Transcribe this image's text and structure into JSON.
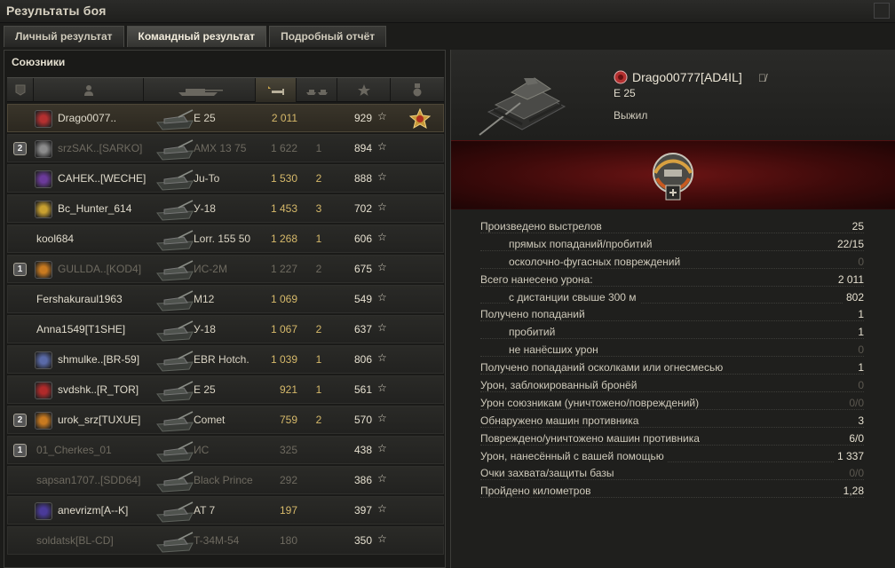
{
  "window": {
    "title": "Результаты боя"
  },
  "tabs": [
    {
      "label": "Личный результат",
      "active": false
    },
    {
      "label": "Командный результат",
      "active": true
    },
    {
      "label": "Подробный отчёт",
      "active": false
    }
  ],
  "team": {
    "label": "Союзники",
    "columns": [
      "platoon-icon",
      "player-icon",
      "tank-icon",
      "damage-icon",
      "frags-icon",
      "xp-star-icon",
      "medal-icon"
    ],
    "rows": [
      {
        "platoon": "",
        "name": "Drago0077..",
        "tank": "E 25",
        "damage": "2 011",
        "frags": "",
        "xp": "929",
        "alive": true,
        "self": true,
        "emblem": "#b43030",
        "medal": true
      },
      {
        "platoon": "2",
        "name": "srzSAK..[SARKO]",
        "tank": "AMX 13 75",
        "damage": "1 622",
        "frags": "1",
        "xp": "894",
        "alive": false,
        "emblem": "#8c8c8c"
      },
      {
        "platoon": "",
        "name": "CAHEK..[WECHE]",
        "tank": "Ju-To",
        "damage": "1 530",
        "frags": "2",
        "xp": "888",
        "alive": true,
        "emblem": "#6b3a9a"
      },
      {
        "platoon": "",
        "name": "Bc_Hunter_614",
        "tank": "У-18",
        "damage": "1 453",
        "frags": "3",
        "xp": "702",
        "alive": true,
        "emblem": "#c8a030"
      },
      {
        "platoon": "",
        "name": "kool684",
        "tank": "Lorr. 155 50",
        "damage": "1 268",
        "frags": "1",
        "xp": "606",
        "alive": true,
        "emblem": ""
      },
      {
        "platoon": "1",
        "name": "GULLDA..[KOD4]",
        "tank": "ИС-2М",
        "damage": "1 227",
        "frags": "2",
        "xp": "675",
        "alive": false,
        "emblem": "#c87a20"
      },
      {
        "platoon": "",
        "name": "Fershakuraul1963",
        "tank": "M12",
        "damage": "1 069",
        "frags": "",
        "xp": "549",
        "alive": true,
        "emblem": ""
      },
      {
        "platoon": "",
        "name": "Anna1549[T1SHE]",
        "tank": "У-18",
        "damage": "1 067",
        "frags": "2",
        "xp": "637",
        "alive": true,
        "emblem": ""
      },
      {
        "platoon": "",
        "name": "shmulke..[BR-59]",
        "tank": "EBR Hotch.",
        "damage": "1 039",
        "frags": "1",
        "xp": "806",
        "alive": true,
        "emblem": "#5a6aa8"
      },
      {
        "platoon": "",
        "name": "svdshk..[R_TOR]",
        "tank": "E 25",
        "damage": "921",
        "frags": "1",
        "xp": "561",
        "alive": true,
        "emblem": "#b02a2a"
      },
      {
        "platoon": "2",
        "name": "urok_srz[TUXUE]",
        "tank": "Comet",
        "damage": "759",
        "frags": "2",
        "xp": "570",
        "alive": true,
        "emblem": "#c87a20"
      },
      {
        "platoon": "1",
        "name": "01_Cherkes_01",
        "tank": "ИС",
        "damage": "325",
        "frags": "",
        "xp": "438",
        "alive": false,
        "emblem": ""
      },
      {
        "platoon": "",
        "name": "sapsan1707..[SDD64]",
        "tank": "Black Prince",
        "damage": "292",
        "frags": "",
        "xp": "386",
        "alive": false,
        "emblem": ""
      },
      {
        "platoon": "",
        "name": "anevrizm[A--K]",
        "tank": "AT 7",
        "damage": "197",
        "frags": "",
        "xp": "397",
        "alive": true,
        "emblem": "#4a3a9a"
      },
      {
        "platoon": "",
        "name": "soldatsk[BL-CD]",
        "tank": "T-34M-54",
        "damage": "180",
        "frags": "",
        "xp": "350",
        "alive": false,
        "emblem": ""
      }
    ]
  },
  "player": {
    "name": "Drago00777[AD4IL]",
    "tank": "E 25",
    "status": "Выжил",
    "eye_icon": "hidden-eye-icon",
    "stats": [
      {
        "label": "Произведено выстрелов",
        "value": "25",
        "indent": 0
      },
      {
        "label": "прямых попаданий/пробитий",
        "value": "22/15",
        "indent": 1
      },
      {
        "label": "осколочно-фугасных повреждений",
        "value": "0",
        "indent": 1,
        "zero": true
      },
      {
        "label": "Всего нанесено урона:",
        "value": "2 011",
        "indent": 0
      },
      {
        "label": "с дистанции свыше 300 м",
        "value": "802",
        "indent": 1
      },
      {
        "label": "Получено попаданий",
        "value": "1",
        "indent": 0
      },
      {
        "label": "пробитий",
        "value": "1",
        "indent": 1
      },
      {
        "label": "не нанёсших урон",
        "value": "0",
        "indent": 1,
        "zero": true
      },
      {
        "label": "Получено попаданий осколками или огнесмесью",
        "value": "1",
        "indent": 0
      },
      {
        "label": "Урон, заблокированный бронёй",
        "value": "0",
        "indent": 0,
        "zero": true
      },
      {
        "label": "Урон союзникам (уничтожено/повреждений)",
        "value": "0/0",
        "indent": 0,
        "zero": true
      },
      {
        "label": "Обнаружено машин противника",
        "value": "3",
        "indent": 0
      },
      {
        "label": "Повреждено/уничтожено машин противника",
        "value": "6/0",
        "indent": 0,
        "partzero": true
      },
      {
        "label": "Урон, нанесённый с вашей помощью",
        "value": "1 337",
        "indent": 0
      },
      {
        "label": "Очки захвата/защиты базы",
        "value": "0/0",
        "indent": 0,
        "zero": true
      },
      {
        "label": "Пройдено километров",
        "value": "1,28",
        "indent": 0
      }
    ]
  }
}
